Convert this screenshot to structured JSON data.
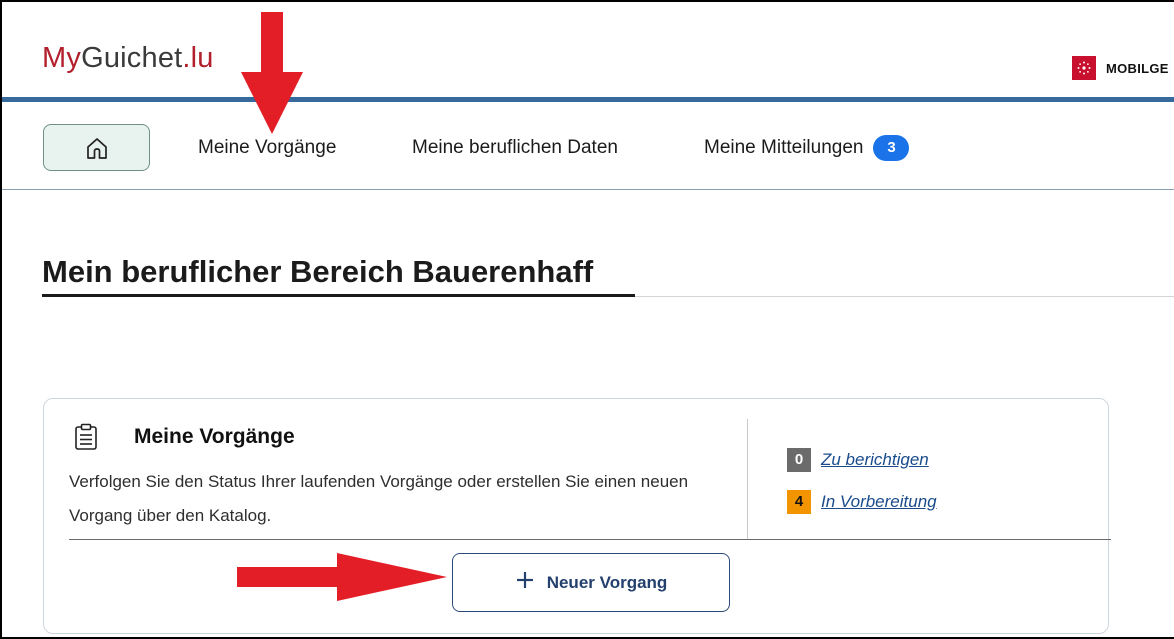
{
  "header": {
    "logo_part1": "My",
    "logo_part2": "Guichet",
    "logo_part3": ".lu",
    "user_label": "MOBILGE"
  },
  "nav": {
    "home_icon": "home-icon",
    "items": [
      {
        "label": "Meine Vorgänge"
      },
      {
        "label": "Meine beruflichen Daten"
      },
      {
        "label": "Meine Mitteilungen",
        "badge": "3"
      }
    ]
  },
  "page": {
    "title": "Mein beruflicher Bereich Bauerenhaff"
  },
  "card": {
    "icon": "clipboard-icon",
    "title": "Meine Vorgänge",
    "description": "Verfolgen Sie den Status Ihrer laufenden Vorgänge oder erstellen Sie einen neuen Vorgang über den Katalog.",
    "statuses": [
      {
        "count": "0",
        "label": "Zu berichtigen",
        "color": "#6b6b6b"
      },
      {
        "count": "4",
        "label": "In Vorbereitung",
        "color": "#f29400"
      }
    ],
    "new_button": {
      "icon": "plus-icon",
      "label": "Neuer Vorgang"
    }
  },
  "colors": {
    "brand_red": "#b3202d",
    "header_rule": "#37699c",
    "badge_blue": "#1a73e8",
    "annotation_red": "#e41e26"
  }
}
